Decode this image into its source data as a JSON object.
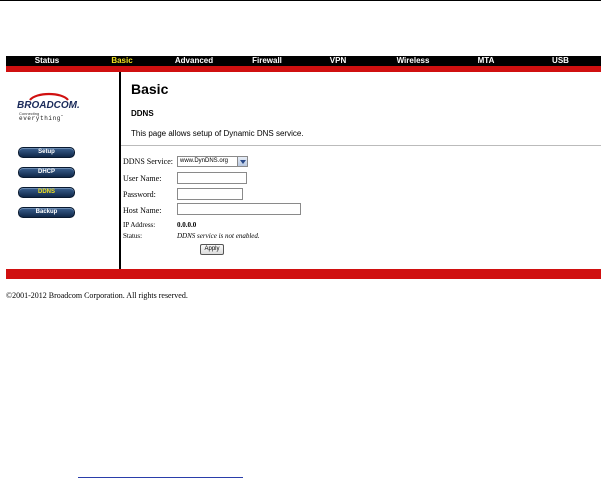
{
  "nav": {
    "items": [
      {
        "label": "Status",
        "active": false
      },
      {
        "label": "Basic",
        "active": true
      },
      {
        "label": "Advanced",
        "active": false
      },
      {
        "label": "Firewall",
        "active": false
      },
      {
        "label": "VPN",
        "active": false
      },
      {
        "label": "Wireless",
        "active": false
      },
      {
        "label": "MTA",
        "active": false
      },
      {
        "label": "USB",
        "active": false
      }
    ],
    "active_color": "#f0e020",
    "bar_color": "#000000",
    "accent_red": "#d01010"
  },
  "logo": {
    "brand": "BROADCOM.",
    "tagline_small": "Connecting",
    "tagline_big": "everything",
    "tm": "™"
  },
  "sidebar": {
    "items": [
      {
        "label": "Setup",
        "active": false
      },
      {
        "label": "DHCP",
        "active": false
      },
      {
        "label": "DDNS",
        "active": true
      },
      {
        "label": "Backup",
        "active": false
      }
    ]
  },
  "main": {
    "title": "Basic",
    "subtitle": "DDNS",
    "description": "This page allows setup of Dynamic DNS service."
  },
  "form": {
    "service_label": "DDNS Service:",
    "service_value": "www.DynDNS.org",
    "username_label": "User Name:",
    "username_value": "",
    "password_label": "Password:",
    "password_value": "",
    "hostname_label": "Host Name:",
    "hostname_value": "",
    "ip_label": "IP Address:",
    "ip_value": "0.0.0.0",
    "status_label": "Status:",
    "status_value": "DDNS service is not enabled.",
    "apply_label": "Apply"
  },
  "footer": {
    "copyright": "©2001-2012 Broadcom Corporation. All rights reserved."
  }
}
